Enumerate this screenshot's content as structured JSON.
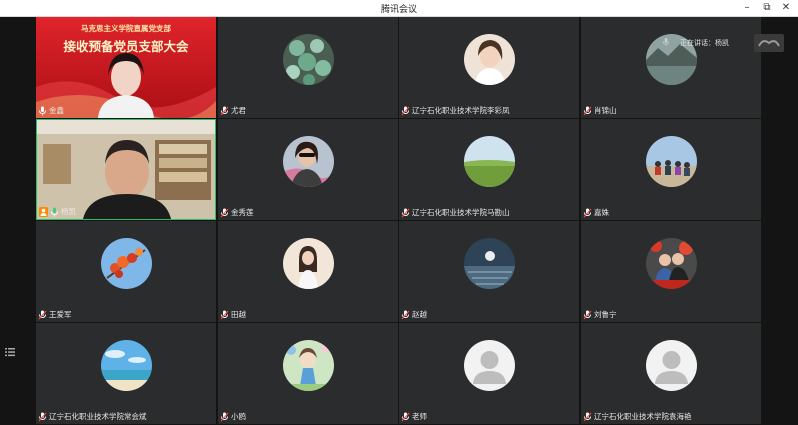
{
  "window": {
    "title": "腾讯会议"
  },
  "active_speaker": {
    "label": "正在讲话：",
    "name": "杨凯"
  },
  "banner": {
    "line1": "马克思主义学院直属党支部",
    "line2": "接收预备党员支部大会"
  },
  "participants": [
    {
      "name": "金鑫",
      "type": "video-banner"
    },
    {
      "name": "尤君",
      "avatar_icon": "succulent-photo"
    },
    {
      "name": "辽宁石化职业技术学院李彩凤",
      "avatar_icon": "woman-portrait-photo"
    },
    {
      "name": "肖锦山",
      "avatar_icon": "lake-mountain-photo"
    },
    {
      "name": "杨凯",
      "type": "video-room",
      "host": true
    },
    {
      "name": "金秀莲",
      "avatar_icon": "woman-sunglasses-photo"
    },
    {
      "name": "辽宁石化职业技术学院马勘山",
      "avatar_icon": "grassland-photo"
    },
    {
      "name": "嘉姝",
      "avatar_icon": "beach-group-photo"
    },
    {
      "name": "王爱军",
      "avatar_icon": "red-leaves-photo"
    },
    {
      "name": "田越",
      "avatar_icon": "girl-illustration"
    },
    {
      "name": "赵越",
      "avatar_icon": "moonlit-sea-photo"
    },
    {
      "name": "刘鲁宁",
      "avatar_icon": "couple-photo"
    },
    {
      "name": "辽宁石化职业技术学院常会斌",
      "avatar_icon": "ocean-sky-photo"
    },
    {
      "name": "小鸥",
      "avatar_icon": "cartoon-character"
    },
    {
      "name": "老师",
      "avatar_icon": "default-user-icon"
    },
    {
      "name": "辽宁石化职业技术学院袁海艳",
      "avatar_icon": "default-user-icon"
    }
  ],
  "colors": {
    "tile": "#2b2c2e",
    "stage": "#141414",
    "banner_red": "#c8161d",
    "active_border": "#2bbd6b"
  }
}
